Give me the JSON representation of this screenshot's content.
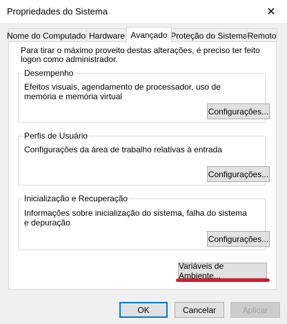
{
  "window": {
    "title": "Propriedades do Sistema",
    "close_symbol": "✕"
  },
  "tabs": [
    {
      "label": "Nome do Computador",
      "active": false
    },
    {
      "label": "Hardware",
      "active": false
    },
    {
      "label": "Avançado",
      "active": true
    },
    {
      "label": "Proteção do Sistema",
      "active": false
    },
    {
      "label": "Remoto",
      "active": false
    }
  ],
  "panel": {
    "intro": "Para tirar o máximo proveito destas alterações, é preciso ter feito logon como administrador.",
    "groups": {
      "performance": {
        "title": "Desempenho",
        "description": "Efeitos visuais, agendamento de processador, uso de memória e memória virtual",
        "button": "Configurações..."
      },
      "user_profiles": {
        "title": "Perfis de Usuário",
        "description": "Configurações da área de trabalho relativas à entrada",
        "button": "Configurações..."
      },
      "startup_recovery": {
        "title": "Inicialização e Recuperação",
        "description": "Informações sobre inicialização do sistema, falha do sistema e depuração",
        "button": "Configurações..."
      }
    },
    "env_button": "Variáveis de Ambiente...",
    "highlight_color": "#d91a2a"
  },
  "footer": {
    "ok": "OK",
    "cancel": "Cancelar",
    "apply": "Aplicar"
  }
}
